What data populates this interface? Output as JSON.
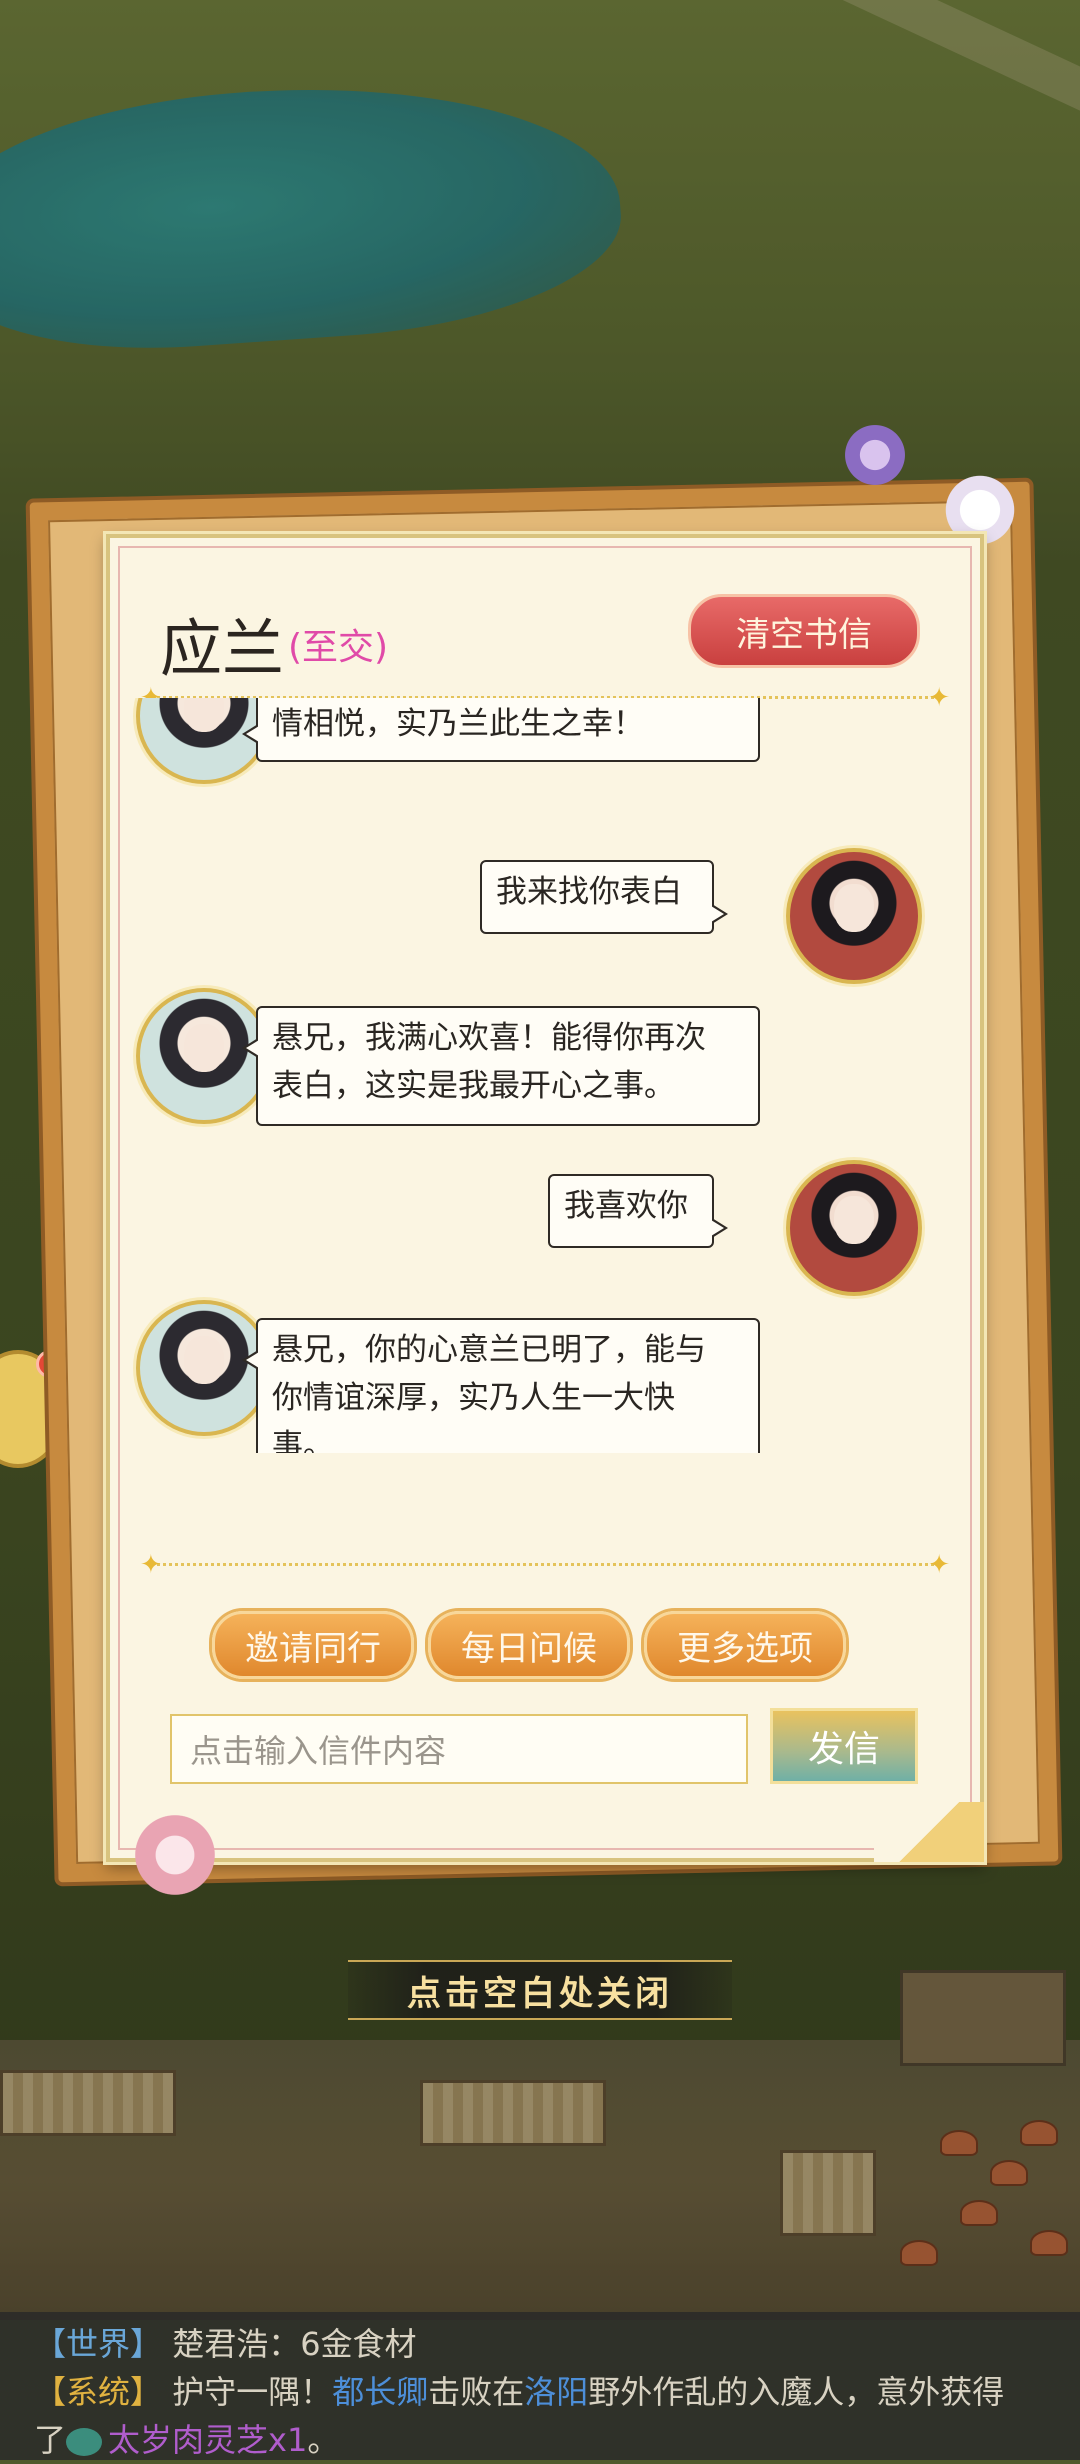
{
  "letter": {
    "contact_name": "应兰",
    "relation": "(至交)",
    "clear_button": "清空书信",
    "messages": [
      {
        "side": "left",
        "text": "情相悦，实乃兰此生之幸！"
      },
      {
        "side": "right",
        "text": "我来找你表白"
      },
      {
        "side": "left",
        "line1": "悬兄，我满心欢喜！能得你再次",
        "line2": "表白，这实是我最开心之事。"
      },
      {
        "side": "right",
        "text": "我喜欢你"
      },
      {
        "side": "left",
        "line1": "悬兄，你的心意兰已明了，能与",
        "line2": "你情谊深厚，实乃人生一大快",
        "line3": "事。"
      }
    ],
    "options": [
      "邀请同行",
      "每日问候",
      "更多选项"
    ],
    "input_placeholder": "点击输入信件内容",
    "send_button": "发信"
  },
  "close_hint": "点击空白处关闭",
  "log": {
    "world_tag": "【世界】",
    "world_text": "楚君浩：6金食材",
    "system_tag": "【系统】",
    "system_pre": "护守一隅！",
    "system_name": "都长卿",
    "system_mid": "击败在",
    "system_place": "洛阳",
    "system_post": "野外作乱的入魔人，意外获得",
    "system_line2_pre": "了",
    "system_item": "太岁肉灵芝",
    "system_count": "x1",
    "system_end": "。"
  },
  "colors": {
    "relation": "#e04aa8",
    "clear_button": "#d9504f",
    "option_button": "#e9992f",
    "world_tag": "#6aa7d8",
    "system_tag": "#e0b240",
    "item": "#b05dcc"
  }
}
